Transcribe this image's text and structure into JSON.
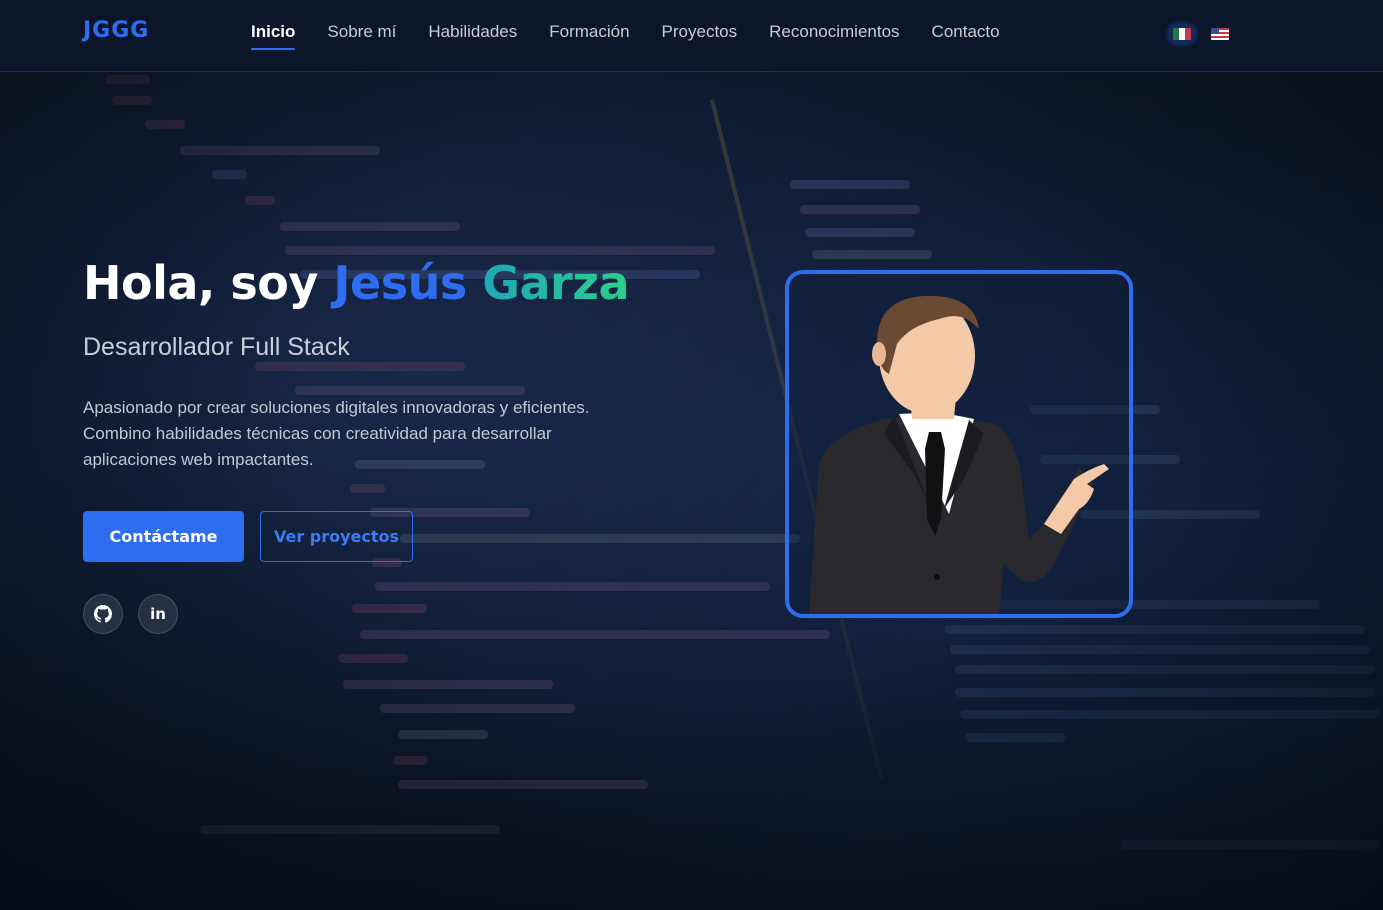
{
  "header": {
    "logo": "JGGG",
    "nav": [
      {
        "label": "Inicio",
        "active": true
      },
      {
        "label": "Sobre mí",
        "active": false
      },
      {
        "label": "Habilidades",
        "active": false
      },
      {
        "label": "Formación",
        "active": false
      },
      {
        "label": "Proyectos",
        "active": false
      },
      {
        "label": "Reconocimientos",
        "active": false
      },
      {
        "label": "Contacto",
        "active": false
      }
    ],
    "languages": [
      {
        "code": "es-MX",
        "icon": "mexico-flag-icon",
        "selected": true
      },
      {
        "code": "en-US",
        "icon": "us-flag-icon",
        "selected": false
      }
    ]
  },
  "hero": {
    "greeting": "Hola, soy",
    "first_name": "Jesús",
    "last_name": "Garza",
    "subtitle": "Desarrollador Full Stack",
    "description": "Apasionado por crear soluciones digitales innovadoras y eficientes. Combino habilidades técnicas con creatividad para desarrollar aplicaciones web impactantes.",
    "primary_button": "Contáctame",
    "secondary_button": "Ver proyectos",
    "social": [
      {
        "icon": "github-icon",
        "glyph": ""
      },
      {
        "icon": "linkedin-icon",
        "glyph": "in"
      }
    ],
    "avatar_icon": "businessman-pointing-illustration"
  },
  "colors": {
    "accent": "#2f6df0",
    "gradient_start": "#1fa6b8",
    "gradient_end": "#2bd08a",
    "background": "#0b1426"
  }
}
